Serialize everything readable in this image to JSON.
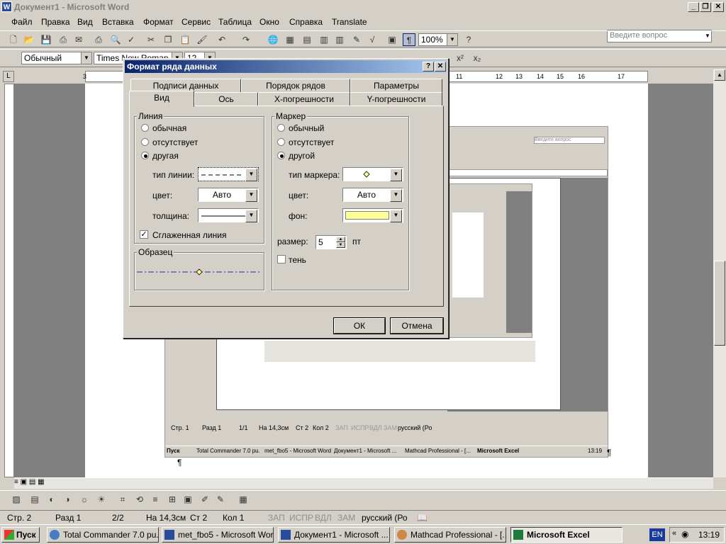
{
  "window": {
    "title": "Документ1 - Microsoft Word",
    "icon": "word-icon"
  },
  "menu": [
    "Файл",
    "Правка",
    "Вид",
    "Вставка",
    "Формат",
    "Сервис",
    "Таблица",
    "Окно",
    "Справка",
    "Translate"
  ],
  "ask_placeholder": "Введите вопрос",
  "toolbar": {
    "zoom": "100%",
    "style": "Обычный",
    "font": "Times New Roman",
    "size": "12"
  },
  "ruler": [
    "3",
    "11",
    "12",
    "13",
    "14",
    "15",
    "16",
    "17"
  ],
  "status": {
    "page": "Стр. 2",
    "section": "Разд 1",
    "pages": "2/2",
    "at": "На 14,3см",
    "line": "Ст 2",
    "col": "Кол 1",
    "rec": "ЗАП",
    "trk": "ИСПР",
    "ext": "ВДЛ",
    "ovr": "ЗАМ",
    "lang": "русский (Ро"
  },
  "taskbar": {
    "start": "Пуск",
    "items": [
      "Total Commander 7.0 pu...",
      "met_fbo5 - Microsoft Word",
      "Документ1 - Microsoft ...",
      "Mathcad Professional - [...",
      "Microsoft Excel"
    ],
    "lang": "EN",
    "clock": "13:19"
  },
  "dialog": {
    "title": "Формат ряда данных",
    "tabs_back": [
      "Подписи данных",
      "Порядок рядов",
      "Параметры"
    ],
    "tabs_front": [
      "Вид",
      "Ось",
      "X-погрешности",
      "Y-погрешности"
    ],
    "line_group": "Линия",
    "line_options": [
      "обычная",
      "отсутствует",
      "другая"
    ],
    "line_selected": 2,
    "line_type_label": "тип линии:",
    "color_label": "цвет:",
    "color_value": "Авто",
    "weight_label": "толщина:",
    "smooth_label": "Сглаженная линия",
    "smooth_checked": true,
    "sample_group": "Образец",
    "marker_group": "Маркер",
    "marker_options": [
      "обычный",
      "отсутствует",
      "другой"
    ],
    "marker_selected": 2,
    "marker_type_label": "тип маркера:",
    "marker_color_label": "цвет:",
    "marker_color_value": "Авто",
    "bg_label": "фон:",
    "bg_color": "#ffff99",
    "size_label": "размер:",
    "size_value": "5",
    "size_unit": "пт",
    "shadow_label": "тень",
    "ok": "ОК",
    "cancel": "Отмена"
  },
  "embedded": {
    "ask": "Введите вопрос",
    "status": [
      "Стр. 1",
      "Разд 1",
      "1/1",
      "На 14,3см",
      "Ст 2",
      "Кол 2",
      "ЗАП",
      "ИСПР",
      "ВДЛ",
      "ЗАМ",
      "русский (Ро"
    ],
    "taskbar": [
      "Пуск",
      "Total Commander 7.0 pu...",
      "met_fbo5 - Microsoft Word",
      "Документ1 - Microsoft ...",
      "Mathcad Professional - [...",
      "Microsoft Excel"
    ],
    "clock": "13:19"
  },
  "colors": {
    "title_active": "#0a246a",
    "title_gradient": "#a6caf0",
    "face": "#d4d0c8",
    "series_line": "#1f2f9f"
  }
}
